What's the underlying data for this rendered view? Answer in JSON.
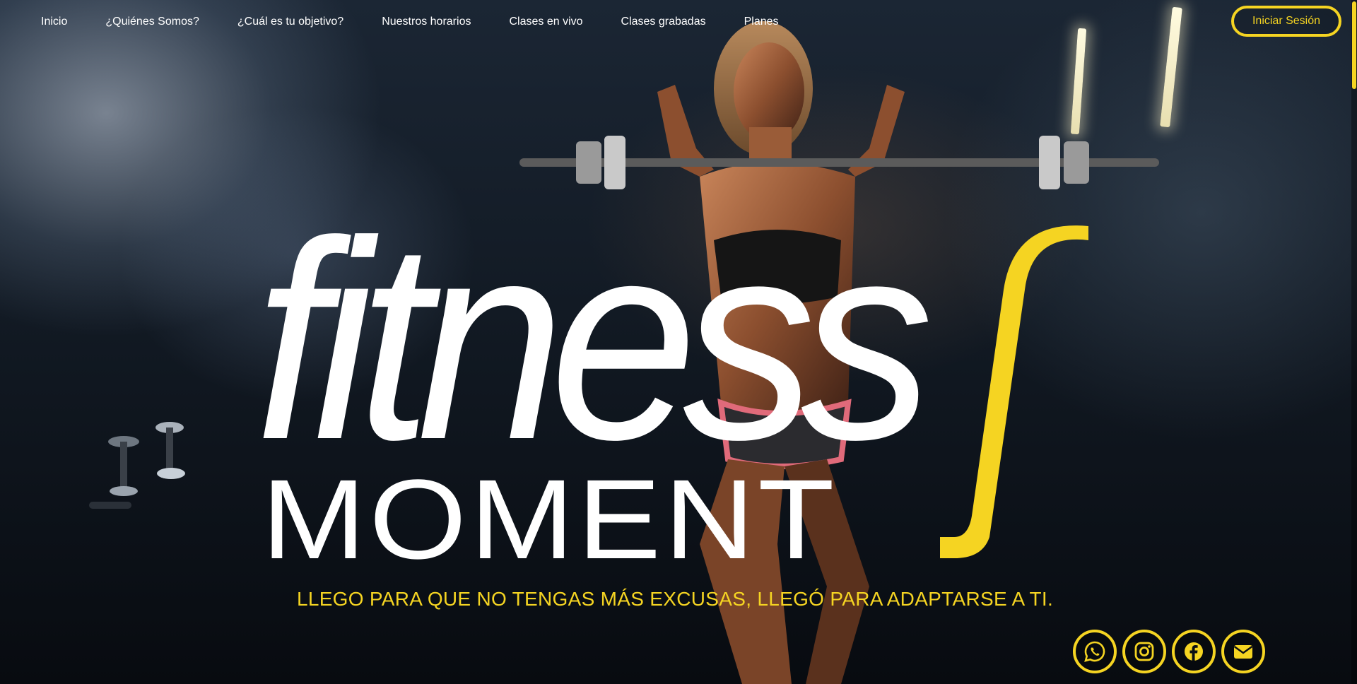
{
  "nav": {
    "items": [
      {
        "label": "Inicio"
      },
      {
        "label": "¿Quiénes Somos?"
      },
      {
        "label": "¿Cuál es tu objetivo?"
      },
      {
        "label": "Nuestros horarios"
      },
      {
        "label": "Clases en vivo"
      },
      {
        "label": "Clases grabadas"
      },
      {
        "label": "Planes"
      }
    ],
    "login_label": "Iniciar Sesión"
  },
  "logo": {
    "line1": "fitness",
    "line2": "MOMENT"
  },
  "hero": {
    "tagline": "LLEGO PARA QUE NO TENGAS MÁS EXCUSAS, LLEGÓ PARA ADAPTARSE A TI."
  },
  "socials": [
    {
      "icon": "whatsapp-icon"
    },
    {
      "icon": "instagram-icon"
    },
    {
      "icon": "facebook-icon"
    },
    {
      "icon": "email-icon"
    }
  ],
  "colors": {
    "accent": "#f5d422",
    "text": "#ffffff",
    "background": "#0b0f14"
  }
}
